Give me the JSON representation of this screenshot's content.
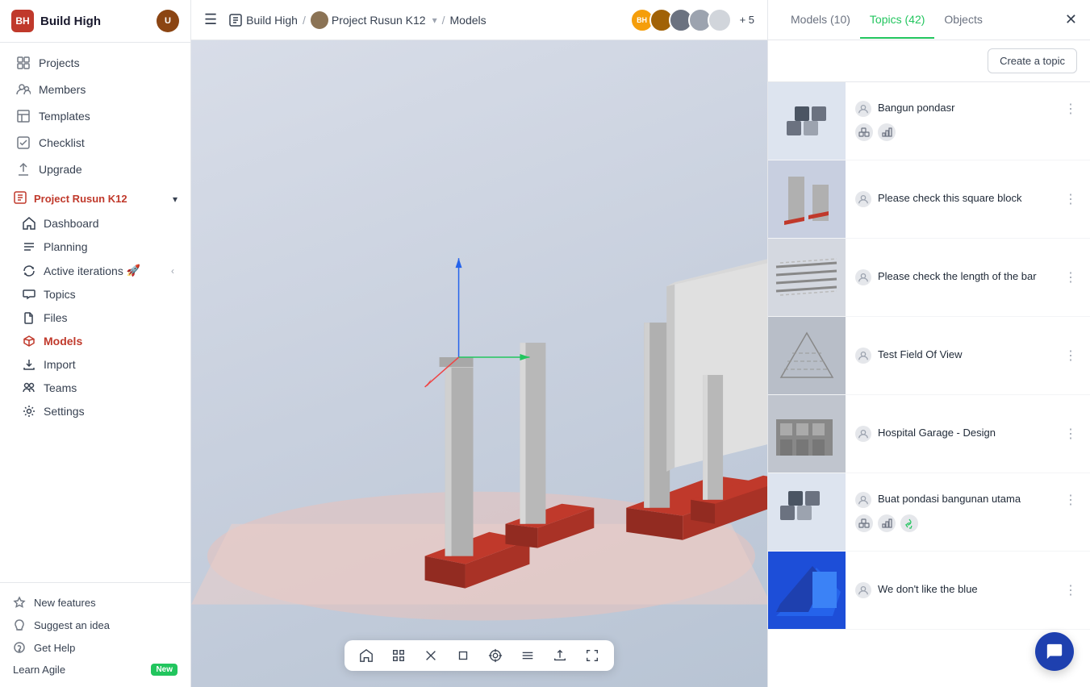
{
  "app": {
    "name": "Build High",
    "logo_initials": "BH"
  },
  "topbar": {
    "breadcrumb": {
      "workspace": "Build High",
      "project": "Project Rusun K12",
      "current": "Models"
    },
    "avatar_count": "+ 5"
  },
  "sidebar": {
    "title": "Build High",
    "nav_items": [
      {
        "label": "Projects",
        "icon": "grid-icon"
      },
      {
        "label": "Members",
        "icon": "users-icon"
      },
      {
        "label": "Templates",
        "icon": "template-icon"
      },
      {
        "label": "Checklist",
        "icon": "checklist-icon"
      },
      {
        "label": "Upgrade",
        "icon": "upgrade-icon"
      }
    ],
    "project_section": {
      "label": "Project Rusun K12",
      "items": [
        {
          "label": "Dashboard",
          "icon": "home-icon"
        },
        {
          "label": "Planning",
          "icon": "planning-icon"
        },
        {
          "label": "Active iterations",
          "icon": "iterations-icon",
          "has_rocket": true
        },
        {
          "label": "Topics",
          "icon": "topics-icon"
        },
        {
          "label": "Files",
          "icon": "files-icon"
        },
        {
          "label": "Models",
          "icon": "models-icon",
          "active": true
        },
        {
          "label": "Import",
          "icon": "import-icon"
        },
        {
          "label": "Teams",
          "icon": "teams-icon"
        },
        {
          "label": "Settings",
          "icon": "settings-icon"
        }
      ]
    },
    "footer_items": [
      {
        "label": "New features"
      },
      {
        "label": "Suggest an idea"
      },
      {
        "label": "Get Help"
      }
    ],
    "learn_agile": "Learn Agile",
    "new_badge": "New"
  },
  "panel": {
    "tabs": [
      {
        "label": "Models (10)",
        "active": false
      },
      {
        "label": "Topics (42)",
        "active": true
      },
      {
        "label": "Objects",
        "active": false
      }
    ],
    "create_topic_btn": "Create a topic",
    "topics": [
      {
        "name": "Bangun pondasr",
        "thumbnail_type": "boxes",
        "has_chart_icon": true,
        "accent": false
      },
      {
        "name": "Please check this square block",
        "thumbnail_type": "column",
        "has_chart_icon": false,
        "accent": false
      },
      {
        "name": "Please check the length of the bar",
        "thumbnail_type": "bars",
        "has_chart_icon": false,
        "accent": false
      },
      {
        "name": "Test Field Of View",
        "thumbnail_type": "field",
        "has_chart_icon": false,
        "accent": true
      },
      {
        "name": "Hospital Garage - Design",
        "thumbnail_type": "garage",
        "has_chart_icon": false,
        "accent": false
      },
      {
        "name": "Buat pondasi bangunan utama",
        "thumbnail_type": "boxes",
        "has_chart_icon": true,
        "accent": true,
        "has_recycle": true
      },
      {
        "name": "We don't like the blue",
        "thumbnail_type": "blue",
        "has_chart_icon": false,
        "accent": false
      }
    ]
  },
  "toolbar": {
    "icons": [
      "home",
      "grid",
      "cross",
      "crop",
      "target",
      "list",
      "upload",
      "expand"
    ]
  }
}
